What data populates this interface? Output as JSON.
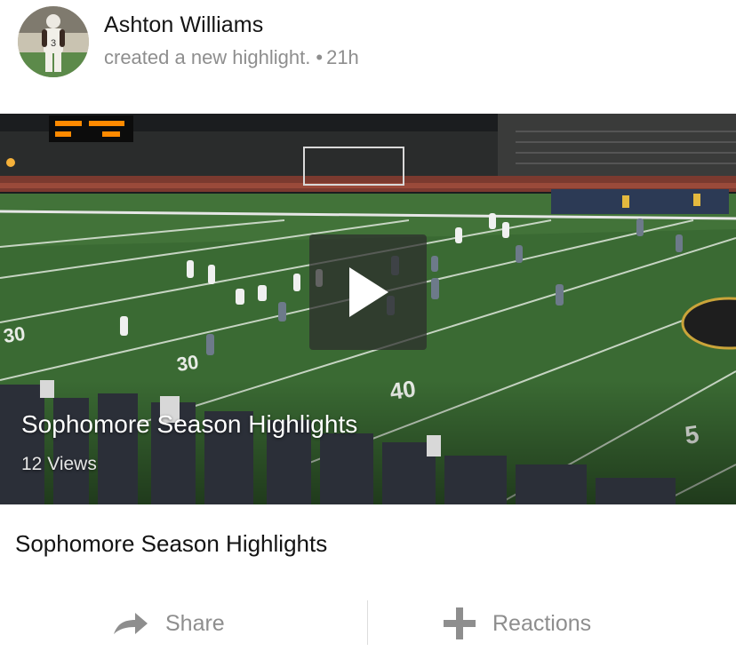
{
  "post": {
    "author_name": "Ashton Williams",
    "action_text": "created a new highlight.",
    "separator": "•",
    "time_ago": "21h",
    "avatar_jersey_number": "3"
  },
  "video": {
    "overlay_title": "Sophomore Season Highlights",
    "views_text": "12 Views",
    "play_icon": "play-icon",
    "field_yard_numbers": [
      "30",
      "30",
      "40",
      "5"
    ]
  },
  "content": {
    "title": "Sophomore Season Highlights"
  },
  "actions": {
    "share_label": "Share",
    "share_icon": "share-arrow-icon",
    "reactions_label": "Reactions",
    "reactions_icon": "plus-icon"
  },
  "colors": {
    "author_text": "#141414",
    "meta_text": "#8e8e8e",
    "field_green": "#3a6a33",
    "divider": "#dddddd"
  }
}
